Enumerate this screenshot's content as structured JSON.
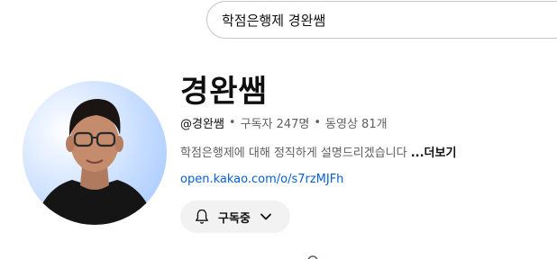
{
  "search": {
    "value": "학점은행제 경완쌤"
  },
  "channel": {
    "name": "경완쌤",
    "handle": "@경완쌤",
    "subscribers": "구독자 247명",
    "videos": "동영상 81개",
    "separator": "•",
    "description": "학점은행제에 대해 정직하게 설명드리겠습니다 ",
    "more_label": "...더보기",
    "link": "open.kakao.com/o/s7rzMJFh"
  },
  "subscribe": {
    "label": "구독중"
  },
  "icons": {
    "subscribe_bell": "bell-icon",
    "subscribe_menu": "chevron-down-icon",
    "tab_search": "search-icon"
  },
  "colors": {
    "link": "#065fd4",
    "secondary_text": "#606060",
    "button_bg": "#f2f2f2"
  }
}
